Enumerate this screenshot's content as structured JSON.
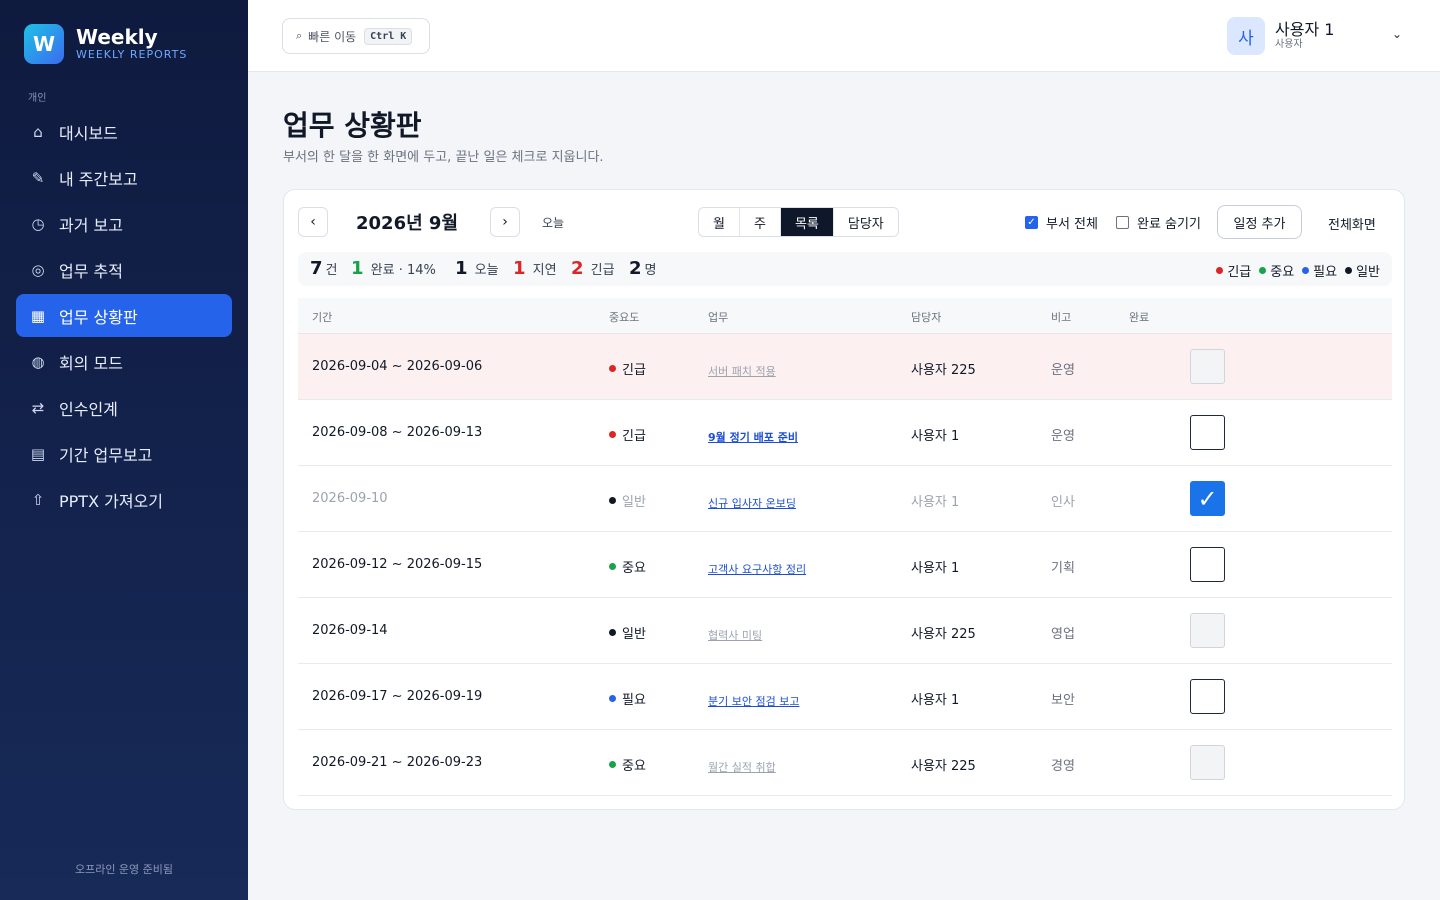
{
  "brand": {
    "logo_letter": "W",
    "name": "Weekly",
    "subtitle": "WEEKLY REPORTS"
  },
  "sidebar": {
    "section_label": "개인",
    "items": [
      {
        "icon": "home-icon",
        "glyph": "⌂",
        "label": "대시보드",
        "active": false
      },
      {
        "icon": "pencil-icon",
        "glyph": "✎",
        "label": "내 주간보고",
        "active": false
      },
      {
        "icon": "clock-icon",
        "glyph": "◷",
        "label": "과거 보고",
        "active": false
      },
      {
        "icon": "target-icon",
        "glyph": "◎",
        "label": "업무 추적",
        "active": false
      },
      {
        "icon": "grid-icon",
        "glyph": "▦",
        "label": "업무 상황판",
        "active": true
      },
      {
        "icon": "globe-icon",
        "glyph": "◍",
        "label": "회의 모드",
        "active": false
      },
      {
        "icon": "swap-icon",
        "glyph": "⇄",
        "label": "인수인계",
        "active": false
      },
      {
        "icon": "list-icon",
        "glyph": "▤",
        "label": "기간 업무보고",
        "active": false
      },
      {
        "icon": "upload-icon",
        "glyph": "⇧",
        "label": "PPTX 가져오기",
        "active": false
      }
    ],
    "footer": "오프라인 운영 준비됨"
  },
  "topbar": {
    "quick_nav_label": "빠른 이동",
    "quick_nav_shortcut": "Ctrl K",
    "user_avatar": "사",
    "user_name": "사용자 1",
    "user_role": "사용자"
  },
  "page": {
    "title": "업무 상황판",
    "subtitle": "부서의 한 달을 한 화면에 두고, 끝난 일은 체크로 지웁니다."
  },
  "toolbar": {
    "month_label": "2026년 9월",
    "today_label": "오늘",
    "views": [
      {
        "label": "월",
        "active": false
      },
      {
        "label": "주",
        "active": false
      },
      {
        "label": "목록",
        "active": true
      },
      {
        "label": "담당자",
        "active": false
      }
    ],
    "dept_all_label": "부서 전체",
    "dept_all_checked": true,
    "hide_done_label": "완료 숨기기",
    "hide_done_checked": false,
    "add_label": "일정 추가",
    "fullscreen_label": "전체화면"
  },
  "stats": {
    "total_num": "7",
    "total_unit": "건",
    "done_num": "1",
    "done_text": "완료 · 14%",
    "today_num": "1",
    "today_text": "오늘",
    "late_num": "1",
    "late_text": "지연",
    "urgent_num": "2",
    "urgent_text": "긴급",
    "people_num": "2",
    "people_unit": "명"
  },
  "colors": {
    "urgent": "#dc2626",
    "important": "#16a34a",
    "required": "#2563eb",
    "normal": "#111827",
    "done_green": "#16a34a"
  },
  "legend": [
    {
      "label": "긴급",
      "color": "#dc2626"
    },
    {
      "label": "중요",
      "color": "#16a34a"
    },
    {
      "label": "필요",
      "color": "#2563eb"
    },
    {
      "label": "일반",
      "color": "#111827"
    }
  ],
  "table": {
    "headers": {
      "period": "기간",
      "priority": "중요도",
      "task": "업무",
      "owner": "담당자",
      "note": "비고",
      "done": "완료"
    },
    "rows": [
      {
        "period": "2026-09-04 ~ 2026-09-06",
        "priority": "긴급",
        "color": "#dc2626",
        "task": "서버 패치 적용",
        "owner": "사용자 225",
        "note": "운영",
        "state": "disabled",
        "highlight": true,
        "done": false,
        "task_style": "muted"
      },
      {
        "period": "2026-09-08 ~ 2026-09-13",
        "priority": "긴급",
        "color": "#dc2626",
        "task": "9월 정기 배포 준비",
        "owner": "사용자 1",
        "note": "운영",
        "state": "open",
        "highlight": false,
        "done": false,
        "task_style": "bold"
      },
      {
        "period": "2026-09-10",
        "priority": "일반",
        "color": "#111827",
        "task": "신규 입사자 온보딩",
        "owner": "사용자 1",
        "note": "인사",
        "state": "checked",
        "highlight": false,
        "done": true,
        "task_style": "link"
      },
      {
        "period": "2026-09-12 ~ 2026-09-15",
        "priority": "중요",
        "color": "#16a34a",
        "task": "고객사 요구사항 정리",
        "owner": "사용자 1",
        "note": "기획",
        "state": "open",
        "highlight": false,
        "done": false,
        "task_style": "link"
      },
      {
        "period": "2026-09-14",
        "priority": "일반",
        "color": "#111827",
        "task": "협력사 미팅",
        "owner": "사용자 225",
        "note": "영업",
        "state": "disabled",
        "highlight": false,
        "done": false,
        "task_style": "muted"
      },
      {
        "period": "2026-09-17 ~ 2026-09-19",
        "priority": "필요",
        "color": "#2563eb",
        "task": "분기 보안 점검 보고",
        "owner": "사용자 1",
        "note": "보안",
        "state": "open",
        "highlight": false,
        "done": false,
        "task_style": "link"
      },
      {
        "period": "2026-09-21 ~ 2026-09-23",
        "priority": "중요",
        "color": "#16a34a",
        "task": "월간 실적 취합",
        "owner": "사용자 225",
        "note": "경영",
        "state": "disabled",
        "highlight": false,
        "done": false,
        "task_style": "muted"
      }
    ]
  }
}
